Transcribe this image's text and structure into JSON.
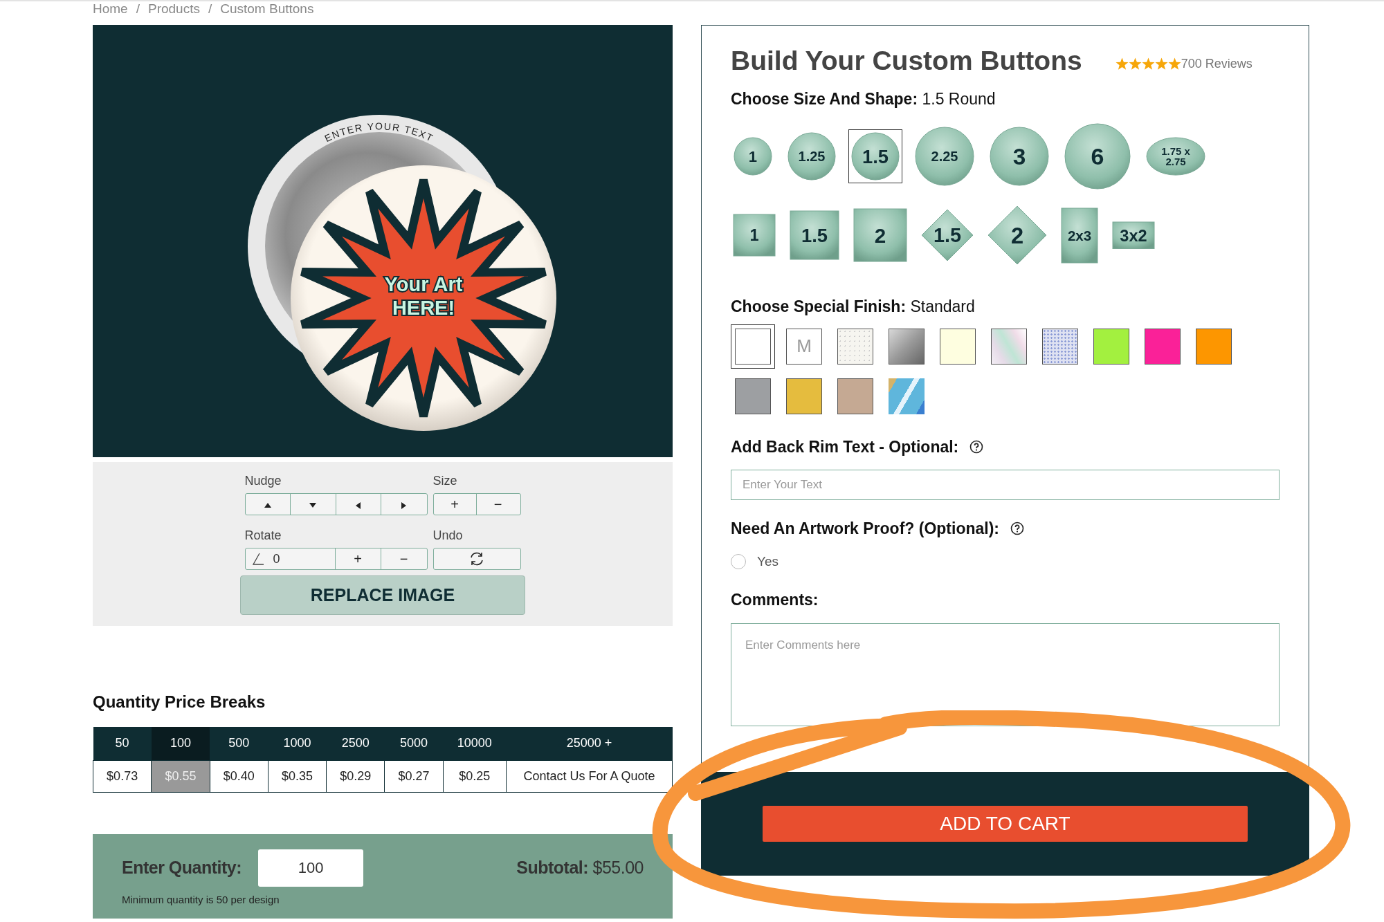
{
  "breadcrumb": {
    "items": [
      "Home",
      "Products",
      "Custom Buttons"
    ],
    "separator": "/"
  },
  "preview": {
    "rim_text": "ENTER YOUR TEXT",
    "art_text": [
      "Your Art",
      "HERE!"
    ]
  },
  "editor": {
    "nudge_label": "Nudge",
    "size_label": "Size",
    "rotate_label": "Rotate",
    "undo_label": "Undo",
    "size_buttons": [
      "+",
      "−"
    ],
    "rotate_value": "0",
    "rotate_buttons": [
      "+",
      "−"
    ],
    "replace_button": "REPLACE IMAGE"
  },
  "price_breaks": {
    "title": "Quantity Price Breaks",
    "columns": [
      {
        "quantity": "50",
        "price": "$0.73",
        "selected": false
      },
      {
        "quantity": "100",
        "price": "$0.55",
        "selected": true
      },
      {
        "quantity": "500",
        "price": "$0.40",
        "selected": false
      },
      {
        "quantity": "1000",
        "price": "$0.35",
        "selected": false
      },
      {
        "quantity": "2500",
        "price": "$0.29",
        "selected": false
      },
      {
        "quantity": "5000",
        "price": "$0.27",
        "selected": false
      },
      {
        "quantity": "10000",
        "price": "$0.25",
        "selected": false
      },
      {
        "quantity": "25000 +",
        "price": "Contact Us For A Quote",
        "selected": false
      }
    ]
  },
  "quantity_panel": {
    "label": "Enter Quantity:",
    "value": "100",
    "subtotal_label": "Subtotal:",
    "subtotal_value": "$55.00",
    "note": "Minimum quantity is 50 per design"
  },
  "builder": {
    "title": "Build Your Custom Buttons",
    "stars": 5,
    "reviews": "700 Reviews",
    "size_label": "Choose Size And Shape:",
    "size_value": "1.5 Round",
    "shapes": [
      {
        "label": "1",
        "kind": "circle",
        "selected": false
      },
      {
        "label": "1.25",
        "kind": "circle",
        "selected": false
      },
      {
        "label": "1.5",
        "kind": "circle",
        "selected": true
      },
      {
        "label": "2.25",
        "kind": "circle",
        "selected": false
      },
      {
        "label": "3",
        "kind": "circle",
        "selected": false
      },
      {
        "label": "6",
        "kind": "circle",
        "selected": false
      },
      {
        "label": "1.75 x\n2.75",
        "kind": "oval",
        "selected": false
      },
      {
        "label": "1",
        "kind": "square",
        "selected": false
      },
      {
        "label": "1.5",
        "kind": "square",
        "selected": false
      },
      {
        "label": "2",
        "kind": "square",
        "selected": false
      },
      {
        "label": "1.5",
        "kind": "diamond",
        "selected": false
      },
      {
        "label": "2",
        "kind": "diamond",
        "selected": false
      },
      {
        "label": "2x3",
        "kind": "tall",
        "selected": false
      },
      {
        "label": "3x2",
        "kind": "wide",
        "selected": false
      }
    ],
    "finish_label": "Choose Special Finish:",
    "finish_value": "Standard",
    "finishes": [
      {
        "kind": "solid",
        "color": "#ffffff",
        "selected": true
      },
      {
        "kind": "letter",
        "color": "#ffffff",
        "letter": "M",
        "selected": false
      },
      {
        "kind": "speckle",
        "color": "#f6f5f0",
        "selected": false
      },
      {
        "kind": "metal",
        "color": "#9a9a9a",
        "selected": false
      },
      {
        "kind": "solid",
        "color": "#fefee0",
        "selected": false
      },
      {
        "kind": "crystal",
        "color": "#e6dbe8",
        "selected": false
      },
      {
        "kind": "glitter",
        "color": "#dfe2f2",
        "selected": false
      },
      {
        "kind": "solid",
        "color": "#a3f03f",
        "selected": false
      },
      {
        "kind": "solid",
        "color": "#fa2198",
        "selected": false
      },
      {
        "kind": "solid",
        "color": "#fd9600",
        "selected": false
      },
      {
        "kind": "solid",
        "color": "#9d9fa2",
        "selected": false
      },
      {
        "kind": "solid",
        "color": "#e5bc3e",
        "selected": false
      },
      {
        "kind": "solid",
        "color": "#c5a993",
        "selected": false
      },
      {
        "kind": "holo",
        "color": "#5fb6dc",
        "selected": false
      }
    ],
    "rim_label": "Add Back Rim Text - Optional:",
    "rim_placeholder": "Enter Your Text",
    "proof_label": "Need An Artwork Proof? (Optional):",
    "proof_option": {
      "label": "Yes",
      "checked": false
    },
    "comments_label": "Comments:",
    "comments_placeholder": "Enter Comments here",
    "cart_button": "ADD TO CART"
  },
  "highlight_ring": true
}
